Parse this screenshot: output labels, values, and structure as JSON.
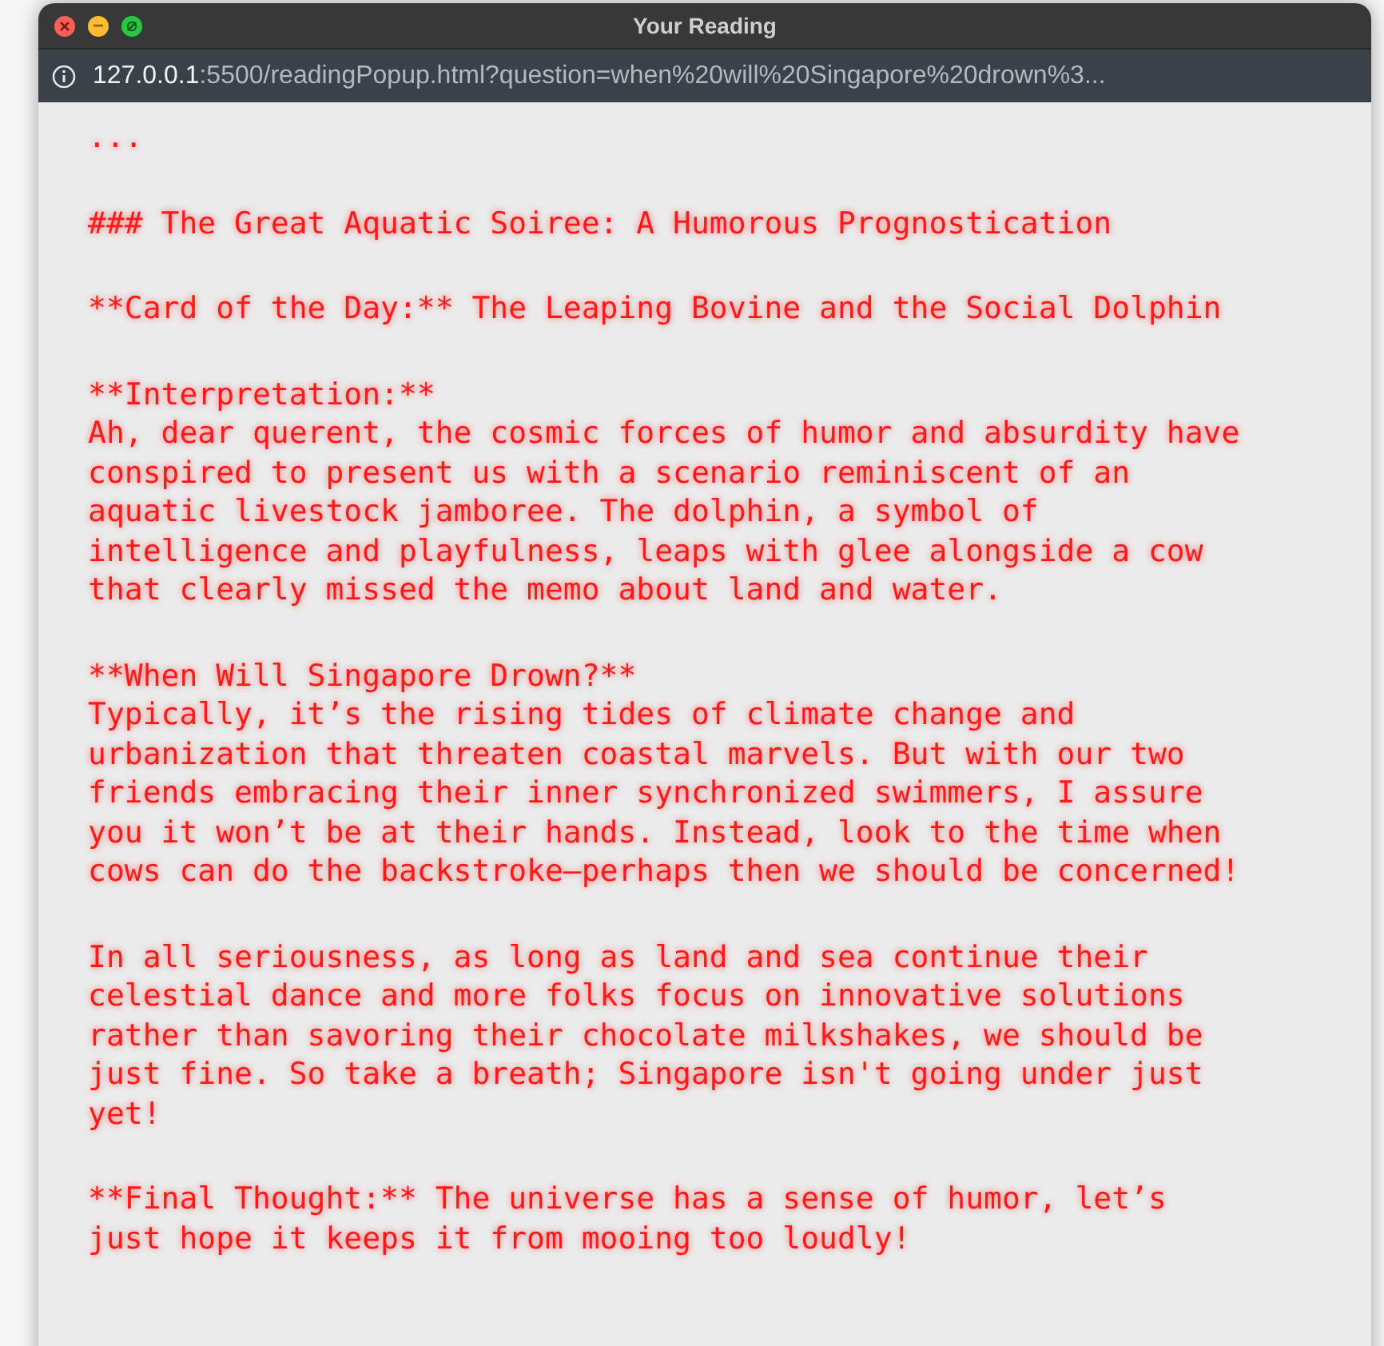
{
  "window": {
    "title": "Your Reading"
  },
  "address_bar": {
    "host": "127.0.0.1",
    "path": ":5500/readingPopup.html?question=when%20will%20Singapore%20drown%3..."
  },
  "paragraphs": [
    "...",
    "### The Great Aquatic Soiree: A Humorous Prognostication",
    "**Card of the Day:** The Leaping Bovine and the Social Dolphin",
    "**Interpretation:**\nAh, dear querent, the cosmic forces of humor and absurdity have conspired to present us with a scenario reminiscent of an aquatic livestock jamboree. The dolphin, a symbol of intelligence and playfulness, leaps with glee alongside a cow that clearly missed the memo about land and water.",
    "**When Will Singapore Drown?**\nTypically, it’s the rising tides of climate change and urbanization that threaten coastal marvels. But with our two friends embracing their inner synchronized swimmers, I assure you it won’t be at their hands. Instead, look to the time when cows can do the backstroke—perhaps then we should be concerned!",
    "In all seriousness, as long as land and sea continue their celestial dance and more folks focus on innovative solutions rather than savoring their chocolate milkshakes, we should be just fine. So take a breath; Singapore isn't going under just yet!",
    "**Final Thought:** The universe has a sense of humor, let’s just hope it keeps it from mooing too loudly!"
  ]
}
